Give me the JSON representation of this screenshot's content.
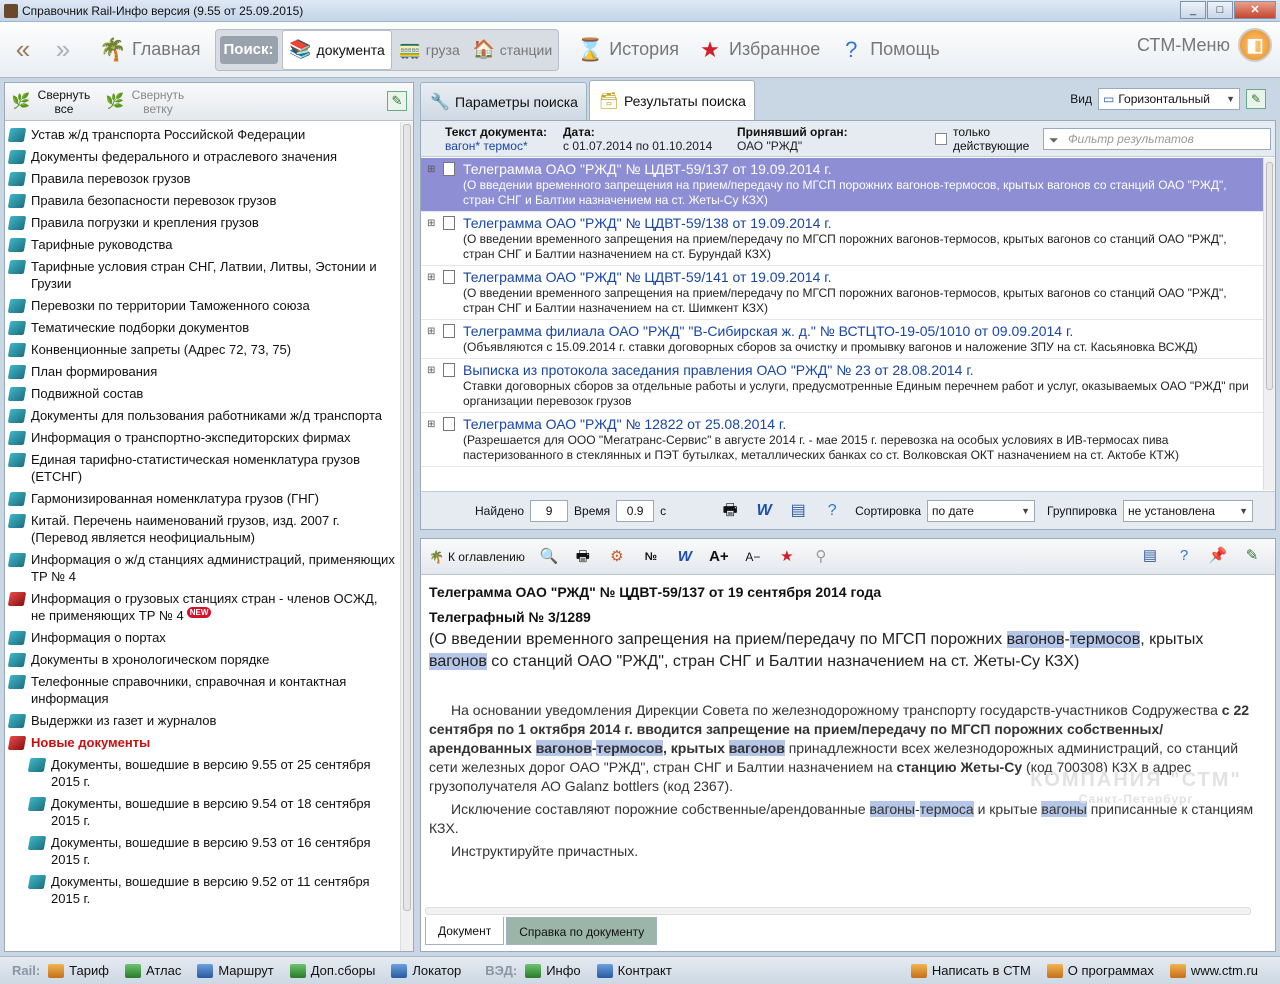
{
  "window": {
    "title": "Справочник Rail-Инфо версия (9.55 от 25.09.2015)"
  },
  "toolbar": {
    "home": "Главная",
    "search_label": "Поиск:",
    "search_options": [
      "документа",
      "груза",
      "станции"
    ],
    "history": "История",
    "favorites": "Избранное",
    "help": "Помощь",
    "ctm_menu": "СТМ-Меню"
  },
  "left": {
    "collapse_all": "Свернуть все",
    "collapse_branch": "Свернуть ветку",
    "tree": [
      {
        "label": "Устав ж/д транспорта Российской Федерации"
      },
      {
        "label": "Документы федерального и отраслевого значения"
      },
      {
        "label": "Правила перевозок грузов"
      },
      {
        "label": "Правила безопасности перевозок грузов"
      },
      {
        "label": "Правила погрузки и крепления грузов"
      },
      {
        "label": "Тарифные руководства"
      },
      {
        "label": "Тарифные условия стран СНГ, Латвии, Литвы, Эстонии и Грузии"
      },
      {
        "label": "Перевозки по территории Таможенного союза"
      },
      {
        "label": "Тематические подборки документов"
      },
      {
        "label": "Конвенционные запреты (Адрес 72, 73, 75)"
      },
      {
        "label": "План формирования"
      },
      {
        "label": "Подвижной состав"
      },
      {
        "label": "Документы для пользования работниками ж/д транспорта"
      },
      {
        "label": "Информация о транспортно-экспедиторских фирмах"
      },
      {
        "label": "Единая тарифно-статистическая номенклатура грузов (ЕТСНГ)"
      },
      {
        "label": "Гармонизированная номенклатура грузов (ГНГ)"
      },
      {
        "label": "Китай. Перечень наименований грузов, изд. 2007 г. (Перевод является неофициальным)"
      },
      {
        "label": "Информация о ж/д станциях администраций, применяющих ТР № 4"
      },
      {
        "label": "Информация о грузовых станциях стран - членов ОСЖД, не применяющих ТР № 4",
        "badge": "NEW"
      },
      {
        "label": "Информация о портах"
      },
      {
        "label": "Документы в хронологическом порядке"
      },
      {
        "label": "Телефонные справочники, справочная и контактная информация"
      },
      {
        "label": "Выдержки из газет и журналов"
      },
      {
        "label": "Новые документы"
      },
      {
        "label": "Документы, вошедшие в версию 9.55 от 25 сентября 2015 г."
      },
      {
        "label": "Документы, вошедшие в версию 9.54 от 18 сентября 2015 г."
      },
      {
        "label": "Документы, вошедшие в версию 9.53 от 16 сентября 2015 г."
      },
      {
        "label": "Документы, вошедшие в версию 9.52 от 11 сентября 2015 г."
      }
    ]
  },
  "search_tabs": {
    "params": "Параметры поиска",
    "results": "Результаты поиска"
  },
  "view": {
    "label": "Вид",
    "value": "Горизонтальный"
  },
  "criteria": {
    "text_label": "Текст документа:",
    "text_value": "вагон* термос*",
    "date_label": "Дата:",
    "date_value": "с 01.07.2014 по 01.10.2014",
    "org_label": "Принявший орган:",
    "org_value": "ОАО \"РЖД\"",
    "active_only": "только действующие",
    "filter_placeholder": "Фильтр результатов"
  },
  "results": [
    {
      "title": "Телеграмма ОАО \"РЖД\" № ЦДВТ-59/137 от 19.09.2014 г.",
      "desc": "(О введении временного запрещения на прием/передачу по МГСП порожних вагонов-термосов, крытых вагонов со станций ОАО \"РЖД\", стран СНГ и Балтии назначением на ст. Жеты-Су КЗХ)"
    },
    {
      "title": "Телеграмма ОАО \"РЖД\" № ЦДВТ-59/138 от 19.09.2014 г.",
      "desc": "(О введении временного запрещения на прием/передачу по МГСП порожних вагонов-термосов, крытых вагонов со станций ОАО \"РЖД\", стран СНГ и Балтии назначением на ст. Бурундай КЗХ)"
    },
    {
      "title": "Телеграмма ОАО \"РЖД\" № ЦДВТ-59/141 от 19.09.2014 г.",
      "desc": "(О введении временного запрещения на прием/передачу по МГСП порожних вагонов-термосов, крытых вагонов со станций ОАО \"РЖД\", стран СНГ и Балтии назначением на ст. Шимкент КЗХ)"
    },
    {
      "title": "Телеграмма филиала ОАО \"РЖД\" \"В-Сибирская ж. д.\" № ВСТЦТО-19-05/1010 от 09.09.2014 г.",
      "desc": "(Объявляются с 15.09.2014 г. ставки договорных сборов за очистку и промывку вагонов и наложение ЗПУ на ст. Касьяновка ВСЖД)"
    },
    {
      "title": "Выписка из протокола заседания правления ОАО \"РЖД\" № 23 от 28.08.2014 г.",
      "desc": "Ставки договорных сборов за отдельные работы и услуги, предусмотренные Единым перечнем работ и услуг, оказываемых ОАО \"РЖД\" при организации перевозок грузов"
    },
    {
      "title": "Телеграмма ОАО \"РЖД\" № 12822 от 25.08.2014 г.",
      "desc": "(Разрешается для ООО \"Мегатранс-Сервис\" в августе 2014 г. - мае 2015 г. перевозка на особых условиях в ИВ-термосах пива пастеризованного в стеклянных и ПЭТ бутылках, металлических банках со ст. Волковская ОКТ назначением на ст. Актобе КТЖ)"
    }
  ],
  "footer": {
    "found_label": "Найдено",
    "found": "9",
    "time_label": "Время",
    "time": "0.9",
    "time_unit": "с",
    "sort_label": "Сортировка",
    "sort_value": "по дате",
    "group_label": "Группировка",
    "group_value": "не установлена"
  },
  "doc": {
    "toc": "К оглавлению",
    "title": "Телеграмма ОАО \"РЖД\" № ЦДВТ-59/137 от 19 сентября 2014 года",
    "subtitle": "Телеграфный № 3/1289",
    "lead_a": "(О введении временного запрещения на прием/передачу по МГСП порожних ",
    "lead_h1": "вагонов",
    "lead_b": "-",
    "lead_h2": "термосов",
    "lead_c": ", крытых ",
    "lead_h3": "вагонов",
    "lead_d": " со станций ОАО \"РЖД\", стран СНГ и Балтии назначением на ст. Жеты-Су КЗХ)",
    "p1_a": "На основании уведомления Дирекции Совета по железнодорожному транспорту государств-участников Содружества ",
    "p1_b": "с 22 сентября по 1 октября 2014 г. вводится запрещение на прием/передачу по МГСП порожних собственных/арендованных ",
    "p1_h1": "вагонов",
    "p1_c": "-",
    "p1_h2": "термосов",
    "p1_d": ", крытых ",
    "p1_h3": "вагонов",
    "p1_e": " принадлежности всех железнодорожных администраций, со станций сети железных дорог ОАО \"РЖД\", стран СНГ и Балтии назначением на ",
    "p1_f": "станцию Жеты-Су",
    "p1_g": " (код 700308) КЗХ в адрес грузополучателя АО Galanz bottlers (код 2367).",
    "p2_a": "Исключение составляют порожние собственные/арендованные ",
    "p2_h1": "вагоны",
    "p2_b": "-",
    "p2_h2": "термоса",
    "p2_c": " и крытые ",
    "p2_h3": "вагоны",
    "p2_d": " приписанные к станциям КЗХ.",
    "p3": "Инструктируйте причастных.",
    "watermark": "КОМПАНИЯ \"СТМ\"",
    "watermark_city": "Санкт-Петербург",
    "tab_doc": "Документ",
    "tab_ref": "Справка по документу"
  },
  "status": {
    "rail_label": "Rail:",
    "rail_items": [
      "Тариф",
      "Атлас",
      "Маршрут",
      "Доп.сборы",
      "Локатор"
    ],
    "ved_label": "ВЭД:",
    "ved_items": [
      "Инфо",
      "Контракт"
    ],
    "right_items": [
      "Написать в СТМ",
      "О программах",
      "www.ctm.ru"
    ]
  }
}
